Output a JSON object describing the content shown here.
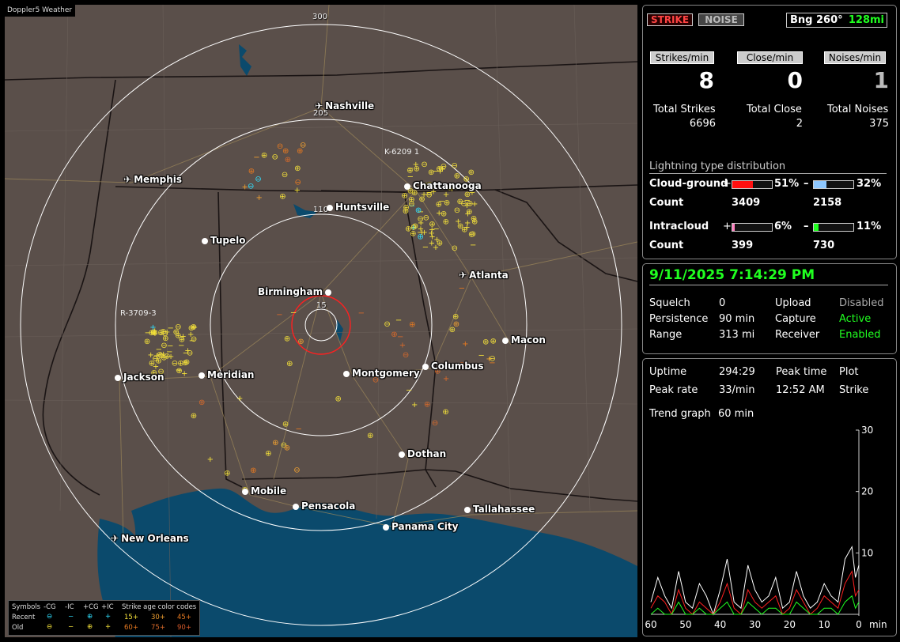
{
  "app": {
    "title": "Doppler5 Weather"
  },
  "map": {
    "range_labels": {
      "r300": "300",
      "r205": "205",
      "r110": "110",
      "r15": "15"
    },
    "cities": {
      "nashville": "Nashville",
      "memphis": "Memphis",
      "chattanooga": "Chattanooga",
      "huntsville": "Huntsville",
      "tupelo": "Tupelo",
      "birmingham": "Birmingham",
      "atlanta": "Atlanta",
      "macon": "Macon",
      "jackson": "Jackson",
      "meridian": "Meridian",
      "montgomery": "Montgomery",
      "columbus": "Columbus",
      "dothan": "Dothan",
      "mobile": "Mobile",
      "pensacola": "Pensacola",
      "tallahassee": "Tallahassee",
      "panama_city": "Panama City",
      "new_orleans": "New Orleans"
    },
    "storm_labels": {
      "k": "K-6209",
      "k_val": "1",
      "r": "R-3709",
      "r_val": "3"
    }
  },
  "legend": {
    "symbols": "Symbols",
    "cg_neg": "-CG",
    "ic_neg": "-IC",
    "cg_pos": "+CG",
    "ic_pos": "+IC",
    "age_codes": "Strike age color codes",
    "recent": "Recent",
    "old": "Old",
    "ages": [
      "15+",
      "30+",
      "45+",
      "60+",
      "75+",
      "90+"
    ],
    "age_colors": [
      "#f4e13a",
      "#f0a030",
      "#e87a20",
      "#e87a20",
      "#d96a2a",
      "#d85a2a"
    ]
  },
  "status": {
    "strike": "STRIKE",
    "noise": "NOISE",
    "bearing": "Bng 260°",
    "distance": "128mi",
    "strikes_per_min_label": "Strikes/min",
    "close_per_min_label": "Close/min",
    "noises_per_min_label": "Noises/min",
    "strikes_per_min": "8",
    "close_per_min": "0",
    "noises_per_min": "1",
    "total_strikes_label": "Total Strikes",
    "total_close_label": "Total Close",
    "total_noises_label": "Total Noises",
    "total_strikes": "6696",
    "total_close": "2",
    "total_noises": "375"
  },
  "distribution": {
    "title": "Lightning type distribution",
    "cg_label": "Cloud-ground",
    "ic_label": "Intracloud",
    "count_label": "Count",
    "plus": "+",
    "minus": "–",
    "cg_pos_pct": "51%",
    "cg_neg_pct": "32%",
    "ic_pos_pct": "6%",
    "ic_neg_pct": "11%",
    "cg_pos_frac": 0.51,
    "cg_neg_frac": 0.32,
    "ic_pos_frac": 0.06,
    "ic_neg_frac": 0.11,
    "cg_pos_count": "3409",
    "cg_neg_count": "2158",
    "ic_pos_count": "399",
    "ic_neg_count": "730",
    "colors": {
      "cg_pos": "#ff1010",
      "cg_neg": "#8ec8ff",
      "ic_pos": "#ff80c0",
      "ic_neg": "#20ff20"
    }
  },
  "info": {
    "datetime": "9/11/2025 7:14:29 PM",
    "squelch_label": "Squelch",
    "squelch": "0",
    "persistence_label": "Persistence",
    "persistence": "90 min",
    "range_label": "Range",
    "range": "313 mi",
    "upload_label": "Upload",
    "upload": "Disabled",
    "capture_label": "Capture",
    "capture": "Active",
    "receiver_label": "Receiver",
    "receiver": "Enabled"
  },
  "trend": {
    "uptime_label": "Uptime",
    "uptime": "294:29",
    "peak_time_label": "Peak time",
    "plot_label": "Plot",
    "peak_rate_label": "Peak rate",
    "peak_rate": "33/min",
    "peak_time": "12:52 AM",
    "plot": "Strike",
    "trend_graph_label": "Trend graph",
    "trend_graph": "60 min",
    "y_ticks": [
      "30",
      "20",
      "10"
    ],
    "x_ticks": [
      "60",
      "50",
      "40",
      "30",
      "20",
      "10",
      "0"
    ],
    "x_unit": "min"
  },
  "chart_data": {
    "type": "line",
    "xlabel": "min",
    "ylabel": "",
    "xlim": [
      60,
      0
    ],
    "ylim": [
      0,
      30
    ],
    "x": [
      60,
      58,
      56,
      54,
      52,
      50,
      48,
      46,
      44,
      42,
      40,
      38,
      36,
      34,
      32,
      30,
      28,
      26,
      24,
      22,
      20,
      18,
      16,
      14,
      12,
      10,
      8,
      6,
      4,
      2,
      1,
      0
    ],
    "series": [
      {
        "values": [
          2,
          6,
          3,
          1,
          7,
          2,
          1,
          5,
          3,
          0,
          4,
          9,
          2,
          1,
          8,
          4,
          2,
          3,
          6,
          1,
          2,
          7,
          3,
          1,
          2,
          5,
          3,
          2,
          9,
          11,
          6,
          8
        ]
      },
      {
        "values": [
          1,
          3,
          2,
          0,
          4,
          1,
          0,
          2,
          1,
          0,
          2,
          5,
          1,
          0,
          4,
          2,
          1,
          2,
          3,
          0,
          1,
          4,
          2,
          0,
          1,
          3,
          2,
          1,
          5,
          7,
          3,
          4
        ]
      },
      {
        "values": [
          0,
          1,
          0,
          0,
          2,
          0,
          0,
          1,
          0,
          0,
          1,
          2,
          0,
          0,
          2,
          1,
          0,
          1,
          1,
          0,
          0,
          2,
          1,
          0,
          0,
          1,
          1,
          0,
          2,
          3,
          1,
          2
        ]
      }
    ]
  }
}
